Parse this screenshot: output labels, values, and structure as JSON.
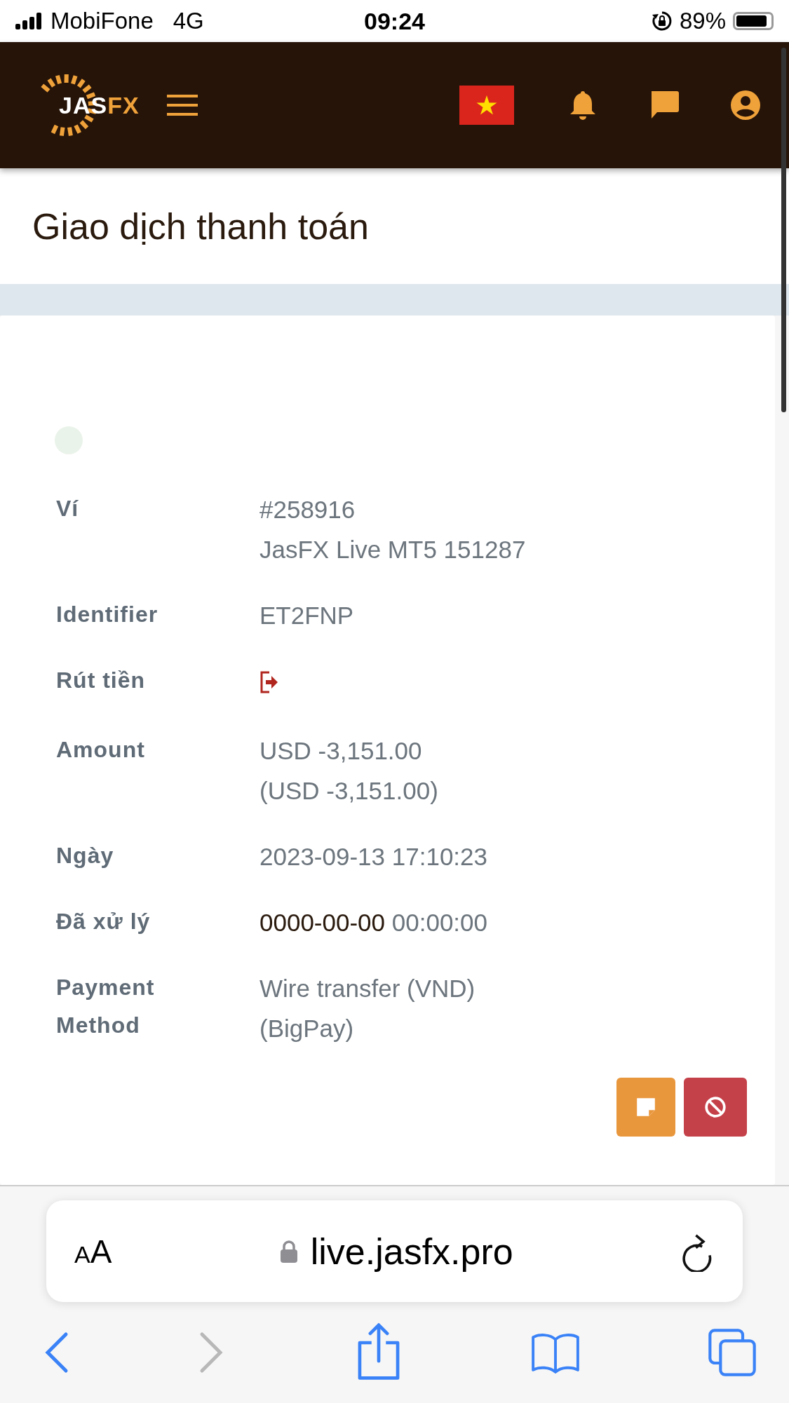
{
  "status_bar": {
    "carrier": "MobiFone",
    "network": "4G",
    "time": "09:24",
    "battery": "89%"
  },
  "header": {
    "logo": {
      "primary": "JAS",
      "accent": "FX"
    }
  },
  "page_title": "Giao dịch thanh toán",
  "rows": [
    {
      "kind": "text",
      "label": [
        "Ví"
      ],
      "lines": [
        "#258916",
        "JasFX Live MT5 151287"
      ]
    },
    {
      "kind": "text",
      "label": [
        "Identifier"
      ],
      "lines": [
        "ET2FNP"
      ]
    },
    {
      "kind": "icon",
      "label": [
        "Rút tiền"
      ]
    },
    {
      "kind": "text",
      "label": [
        "Amount"
      ],
      "lines": [
        "USD -3,151.00",
        "(USD -3,151.00)"
      ]
    },
    {
      "kind": "text",
      "label": [
        "Ngày"
      ],
      "lines": [
        "2023-09-13 17:10:23"
      ]
    },
    {
      "kind": "datetime",
      "label": [
        "Đã xử lý"
      ],
      "date": "0000-00-00",
      "time": "00:00:00"
    },
    {
      "kind": "text",
      "label": [
        "Payment",
        "Method"
      ],
      "lines": [
        "Wire transfer (VND)",
        "(BigPay)"
      ]
    }
  ],
  "browser": {
    "text_size_button": "AA",
    "url": "live.jasfx.pro",
    "back": {
      "disabled": false
    },
    "forward": {
      "disabled": true
    }
  }
}
